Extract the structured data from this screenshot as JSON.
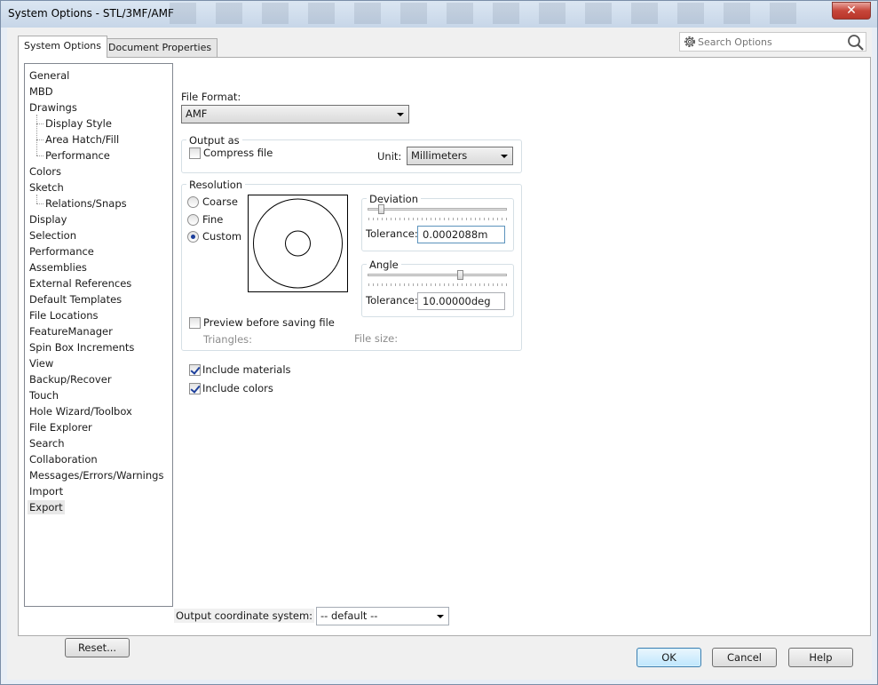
{
  "window": {
    "title": "System Options - STL/3MF/AMF",
    "close_symbol": "✕"
  },
  "tabs": [
    {
      "label": "System Options",
      "active": true
    },
    {
      "label": "Document Properties",
      "active": false
    }
  ],
  "search": {
    "placeholder": "Search Options"
  },
  "tree": {
    "items": [
      {
        "label": "General"
      },
      {
        "label": "MBD"
      },
      {
        "label": "Drawings"
      },
      {
        "label": "Display Style",
        "child": true
      },
      {
        "label": "Area Hatch/Fill",
        "child": true
      },
      {
        "label": "Performance",
        "child": true
      },
      {
        "label": "Colors"
      },
      {
        "label": "Sketch"
      },
      {
        "label": "Relations/Snaps",
        "child": true
      },
      {
        "label": "Display"
      },
      {
        "label": "Selection"
      },
      {
        "label": "Performance"
      },
      {
        "label": "Assemblies"
      },
      {
        "label": "External References"
      },
      {
        "label": "Default Templates"
      },
      {
        "label": "File Locations"
      },
      {
        "label": "FeatureManager"
      },
      {
        "label": "Spin Box Increments"
      },
      {
        "label": "View"
      },
      {
        "label": "Backup/Recover"
      },
      {
        "label": "Touch"
      },
      {
        "label": "Hole Wizard/Toolbox"
      },
      {
        "label": "File Explorer"
      },
      {
        "label": "Search"
      },
      {
        "label": "Collaboration"
      },
      {
        "label": "Messages/Errors/Warnings"
      },
      {
        "label": "Import"
      },
      {
        "label": "Export",
        "selected": true
      }
    ]
  },
  "export": {
    "file_format_label": "File Format:",
    "file_format_value": "AMF",
    "output_as": {
      "title": "Output as",
      "compress_label": "Compress file",
      "compress_checked": false,
      "unit_label": "Unit:",
      "unit_value": "Millimeters"
    },
    "resolution": {
      "title": "Resolution",
      "options": [
        {
          "label": "Coarse",
          "selected": false
        },
        {
          "label": "Fine",
          "selected": false
        },
        {
          "label": "Custom",
          "selected": true
        }
      ],
      "deviation": {
        "title": "Deviation",
        "tolerance_label": "Tolerance:",
        "tolerance_value": "0.0002088m",
        "slider_fraction": 0.08
      },
      "angle": {
        "title": "Angle",
        "tolerance_label": "Tolerance:",
        "tolerance_value": "10.00000deg",
        "slider_fraction": 0.67
      },
      "preview_label": "Preview before saving file",
      "preview_checked": false,
      "triangles_label": "Triangles:",
      "file_size_label": "File size:"
    },
    "include_materials_label": "Include materials",
    "include_materials_checked": true,
    "include_colors_label": "Include colors",
    "include_colors_checked": true,
    "coord_system_label": "Output coordinate system:",
    "coord_system_value": "-- default --"
  },
  "buttons": {
    "reset": "Reset...",
    "ok": "OK",
    "cancel": "Cancel",
    "help": "Help"
  }
}
